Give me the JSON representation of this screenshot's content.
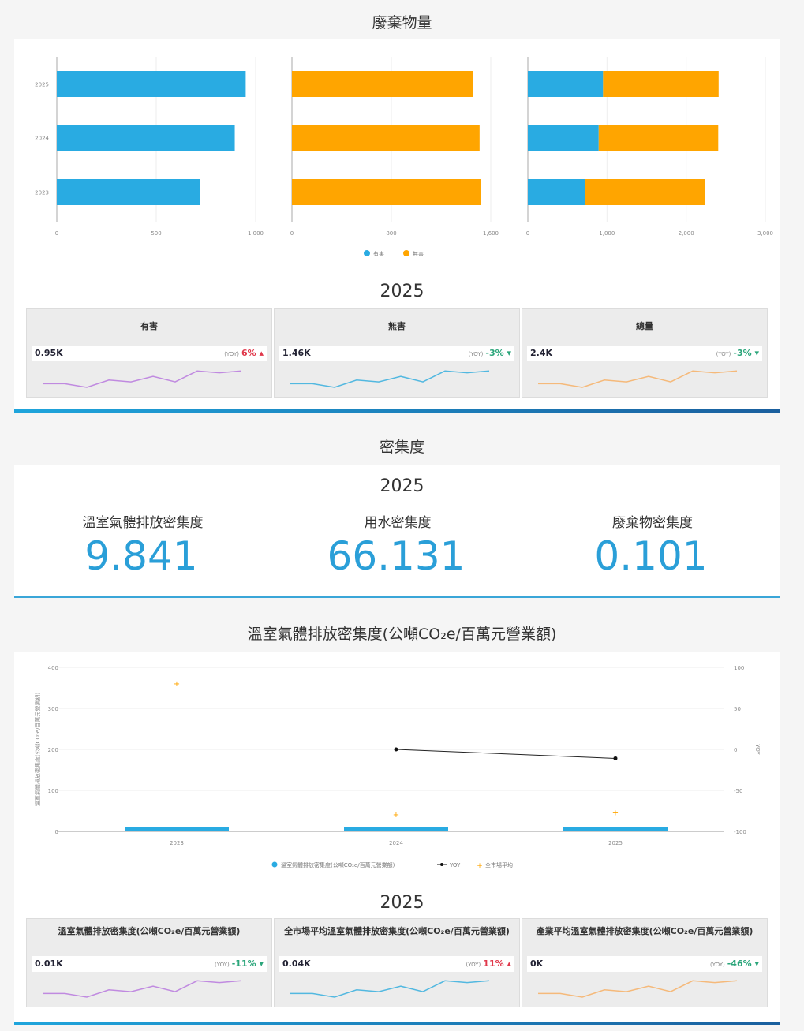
{
  "waste": {
    "title": "廢棄物量",
    "legend": [
      "有害",
      "無害"
    ],
    "years": [
      "2025",
      "2024",
      "2023"
    ],
    "hazard_ticks": [
      "0",
      "500",
      "1,000"
    ],
    "nonhazard_ticks": [
      "0",
      "800",
      "1,600"
    ],
    "total_ticks": [
      "0",
      "1,000",
      "2,000",
      "3,000"
    ]
  },
  "chart_data": [
    {
      "type": "bar",
      "categories": [
        "2025",
        "2024",
        "2023"
      ],
      "series": [
        {
          "name": "有害",
          "values": [
            950,
            895,
            720
          ]
        },
        {
          "name": "無害",
          "values": [
            1460,
            1510,
            1520
          ]
        }
      ],
      "colors": [
        "#29abe2",
        "#ffa500"
      ]
    },
    {
      "type": "bar",
      "categories": [
        "2023",
        "2024",
        "2025"
      ],
      "series": [
        {
          "name": "溫室氣體排放密集度(公噸CO₂e/百萬元營業額)",
          "values": [
            10,
            10,
            10
          ]
        },
        {
          "name": "YOY",
          "values": [
            null,
            0,
            -11
          ]
        },
        {
          "name": "全市場平均",
          "values": [
            360,
            40,
            45
          ]
        }
      ],
      "left_ticks": [
        "400",
        "300",
        "200",
        "100",
        "0"
      ],
      "right_ticks": [
        "100",
        "50",
        "0",
        "-50",
        "-100"
      ]
    }
  ],
  "waste_year": "2025",
  "waste_tiles": [
    {
      "title": "有害",
      "value": "0.95K",
      "yoy_label": "(YOY)",
      "yoy": "6%",
      "dir": "up",
      "color": "#c08ae0"
    },
    {
      "title": "無害",
      "value": "1.46K",
      "yoy_label": "(YOY)",
      "yoy": "-3%",
      "dir": "down",
      "color": "#52b8e0"
    },
    {
      "title": "總量",
      "value": "2.4K",
      "yoy_label": "(YOY)",
      "yoy": "-3%",
      "dir": "down",
      "color": "#f5b97a"
    }
  ],
  "intensity": {
    "title": "密集度",
    "year": "2025",
    "kpis": [
      {
        "label": "溫室氣體排放密集度",
        "value": "9.841"
      },
      {
        "label": "用水密集度",
        "value": "66.131"
      },
      {
        "label": "廢棄物密集度",
        "value": "0.101"
      }
    ]
  },
  "ghg": {
    "title": "溫室氣體排放密集度(公噸CO₂e/百萬元營業額)",
    "y_left_label": "溫室氣體排放密集度(公噸CO₂e/百萬元營業額)",
    "y_right_label": "YOY",
    "x_ticks": [
      "2023",
      "2024",
      "2025"
    ],
    "legend": [
      "溫室氣體排放密集度(公噸CO₂e/百萬元營業額)",
      "YOY",
      "全市場平均"
    ],
    "year": "2025",
    "tiles": [
      {
        "title": "溫室氣體排放密集度(公噸CO₂e/百萬元營業額)",
        "value": "0.01K",
        "yoy_label": "(YOY)",
        "yoy": "-11%",
        "dir": "down",
        "color": "#c08ae0"
      },
      {
        "title": "全市場平均溫室氣體排放密集度(公噸CO₂e/百萬元營業額)",
        "value": "0.04K",
        "yoy_label": "(YOY)",
        "yoy": "11%",
        "dir": "up",
        "color": "#52b8e0"
      },
      {
        "title": "產業平均溫室氣體排放密集度(公噸CO₂e/百萬元營業額)",
        "value": "0K",
        "yoy_label": "(YOY)",
        "yoy": "-46%",
        "dir": "down",
        "color": "#f5b97a"
      }
    ]
  }
}
